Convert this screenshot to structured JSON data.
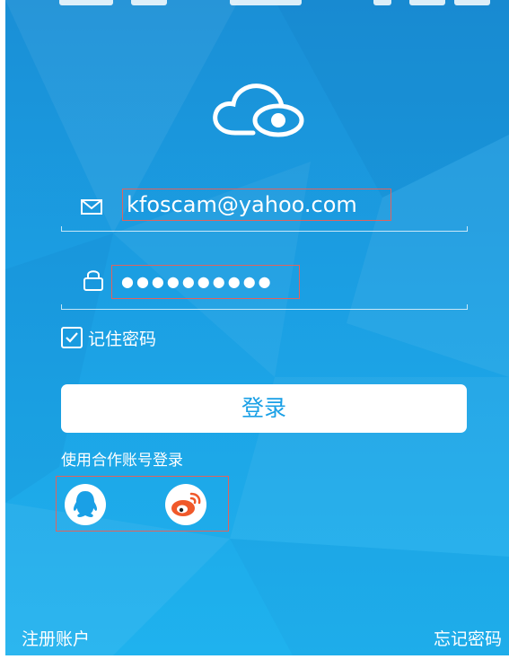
{
  "login_form": {
    "email_value": "kfoscam@yahoo.com",
    "password_mask": "●●●●●●●●●●",
    "remember_label": "记住密码",
    "remember_checked": true,
    "login_button_label": "登录"
  },
  "partner_login": {
    "label": "使用合作账号登录",
    "providers": [
      {
        "name": "qq-icon"
      },
      {
        "name": "weibo-icon"
      }
    ]
  },
  "footer": {
    "register_label": "注册账户",
    "forgot_label": "忘记密码"
  },
  "colors": {
    "background_top": "#1a8fd6",
    "background_bottom": "#1fb2ee",
    "accent_blue": "#1aa0e6",
    "highlight_red": "#e0635e",
    "weibo_orange": "#f0592a",
    "white": "#ffffff"
  }
}
